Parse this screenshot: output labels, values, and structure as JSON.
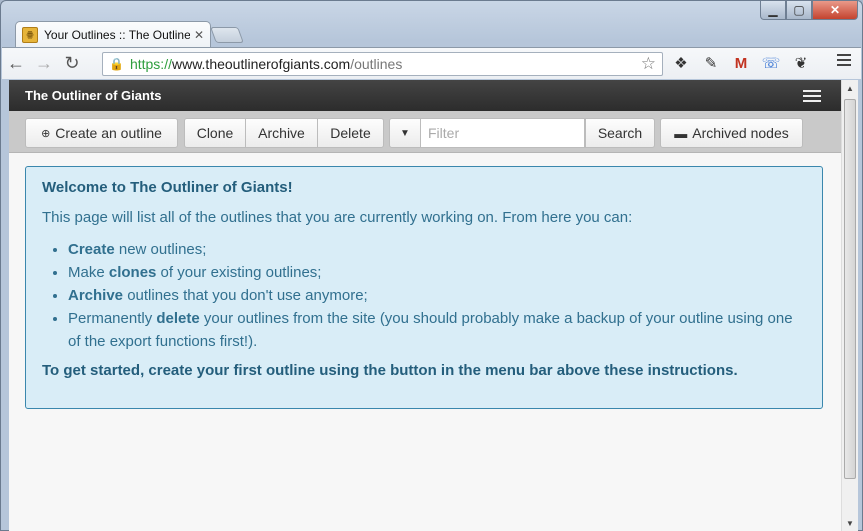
{
  "browser": {
    "tab_title": "Your Outlines :: The Outliner of Giants",
    "tab_favicon": "outliner-favicon",
    "url_scheme": "https://",
    "url_host": "www.theoutlinerofgiants.com",
    "url_path": "/outlines"
  },
  "navbar": {
    "brand": "The Outliner of Giants"
  },
  "actions": {
    "create": "Create an outline",
    "clone": "Clone",
    "archive": "Archive",
    "delete": "Delete",
    "filter_placeholder": "Filter",
    "search": "Search",
    "archived": "Archived nodes"
  },
  "welcome": {
    "heading": "Welcome to The Outliner of Giants!",
    "intro": "This page will list all of the outlines that you are currently working on. From here you can:",
    "items": [
      {
        "strong": "Create",
        "rest": " new outlines;",
        "pre": ""
      },
      {
        "pre": "Make ",
        "strong": "clones",
        "rest": " of your existing outlines;"
      },
      {
        "pre": "",
        "strong": "Archive",
        "rest": " outlines that you don't use anymore;"
      },
      {
        "pre": "Permanently ",
        "strong": "delete",
        "rest": " your outlines from the site (you should probably make a backup of your outline using one of the export functions first!)."
      }
    ],
    "final": "To get started, create your first outline using the button in the menu bar above these instructions."
  },
  "colors": {
    "alert_bg": "#d9edf7",
    "alert_border": "#3a87ad",
    "navbar_bg": "#333333"
  }
}
